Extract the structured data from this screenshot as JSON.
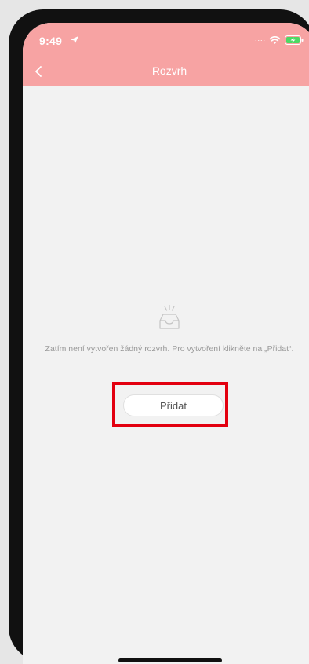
{
  "status_bar": {
    "time": "9:49",
    "signal_text": "....",
    "icons": [
      "location-arrow-icon",
      "wifi-icon",
      "battery-charging-icon"
    ]
  },
  "nav": {
    "title": "Rozvrh",
    "back_icon": "chevron-left-icon"
  },
  "empty_state": {
    "icon": "empty-inbox-icon",
    "message": "Zatím není vytvořen žádný rozvrh. Pro vytvoření klikněte na „Přidat“.",
    "button_label": "Přidat"
  },
  "colors": {
    "header": "#f7a3a3",
    "highlight": "#e3000f",
    "background": "#f2f2f2"
  }
}
